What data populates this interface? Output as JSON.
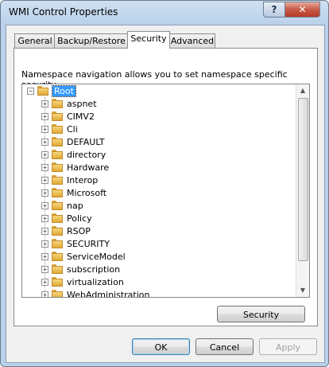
{
  "window": {
    "title": "WMI Control Properties"
  },
  "titlebar": {
    "help_label": "?",
    "close_label": "✕"
  },
  "tabs": [
    {
      "label": "General"
    },
    {
      "label": "Backup/Restore"
    },
    {
      "label": "Security"
    },
    {
      "label": "Advanced"
    }
  ],
  "panel": {
    "description": "Namespace navigation allows you to set namespace specific security.",
    "security_button": "Security"
  },
  "tree": {
    "root": {
      "label": "Root",
      "expander": "−"
    },
    "children": [
      {
        "label": "aspnet",
        "expander": "+"
      },
      {
        "label": "CIMV2",
        "expander": "+"
      },
      {
        "label": "Cli",
        "expander": "+"
      },
      {
        "label": "DEFAULT",
        "expander": "+"
      },
      {
        "label": "directory",
        "expander": "+"
      },
      {
        "label": "Hardware",
        "expander": "+"
      },
      {
        "label": "Interop",
        "expander": "+"
      },
      {
        "label": "Microsoft",
        "expander": "+"
      },
      {
        "label": "nap",
        "expander": "+"
      },
      {
        "label": "Policy",
        "expander": "+"
      },
      {
        "label": "RSOP",
        "expander": "+"
      },
      {
        "label": "SECURITY",
        "expander": "+"
      },
      {
        "label": "ServiceModel",
        "expander": "+"
      },
      {
        "label": "subscription",
        "expander": "+"
      },
      {
        "label": "virtualization",
        "expander": "+"
      },
      {
        "label": "WebAdministration",
        "expander": "+"
      }
    ]
  },
  "scrollbar": {
    "up_arrow": "▲",
    "down_arrow": "▼"
  },
  "buttons": {
    "ok": "OK",
    "cancel": "Cancel",
    "apply": "Apply"
  }
}
